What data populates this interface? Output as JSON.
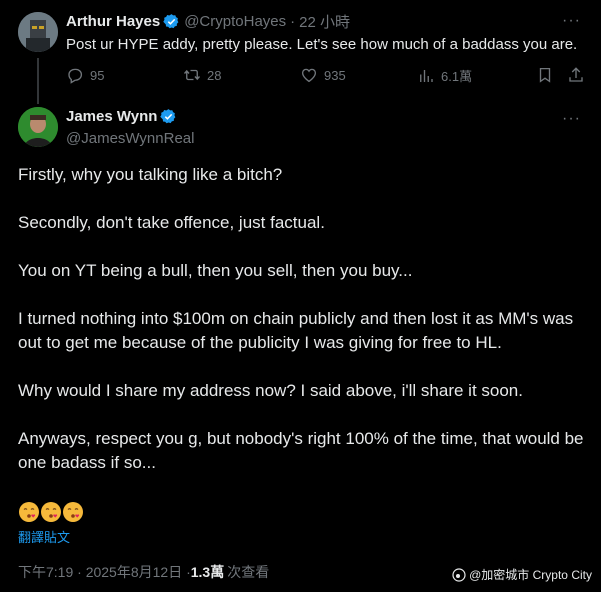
{
  "parent": {
    "author": "Arthur Hayes",
    "handle": "@CryptoHayes",
    "time": "22 小時",
    "text": "Post ur HYPE addy, pretty please. Let's see how much of a baddass you are.",
    "stats": {
      "replies": "95",
      "reposts": "28",
      "likes": "935",
      "views": "6.1萬"
    }
  },
  "reply": {
    "author": "James Wynn",
    "handle": "@JamesWynnReal",
    "paragraphs": [
      "Firstly, why you talking like a bitch?",
      "Secondly, don't take offence, just factual.",
      "You on YT being a bull, then you sell, then you buy...",
      "I turned nothing into $100m on chain publicly and then lost it as MM's was out to get me because of the publicity I was giving for free to HL.",
      "Why would I share my address now? I said above, i'll share it soon.",
      "Anyways, respect you g, but nobody's right 100% of the time, that would be one badass if so..."
    ],
    "translate_label": "翻譯貼文",
    "timestamp": "下午7:19 · 2025年8月12日 · ",
    "views_count": "1.3萬",
    "views_label": "次查看"
  },
  "watermark": "@加密城市 Crypto City",
  "colors": {
    "background": "#000000",
    "text": "#e7e9ea",
    "muted": "#71767b",
    "accent": "#1d9bf0"
  },
  "icons": [
    "verified-badge-icon",
    "more-icon",
    "reply-icon",
    "repost-icon",
    "like-icon",
    "views-icon",
    "bookmark-icon",
    "share-icon",
    "kiss-emoji-icon"
  ]
}
